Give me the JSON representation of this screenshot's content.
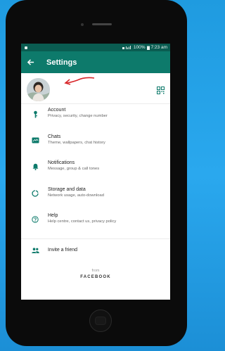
{
  "statusbar": {
    "battery": "100%",
    "time": "7:23 am"
  },
  "appbar": {
    "title": "Settings"
  },
  "menu": [
    {
      "icon": "key-icon",
      "title": "Account",
      "subtitle": "Privacy, security, change number"
    },
    {
      "icon": "chat-icon",
      "title": "Chats",
      "subtitle": "Theme, wallpapers, chat history"
    },
    {
      "icon": "bell-icon",
      "title": "Notifications",
      "subtitle": "Message, group & call tones"
    },
    {
      "icon": "data-usage-icon",
      "title": "Storage and data",
      "subtitle": "Network usage, auto-download"
    },
    {
      "icon": "help-icon",
      "title": "Help",
      "subtitle": "Help centre, contact us, privacy policy"
    }
  ],
  "invite": {
    "icon": "people-icon",
    "label": "Invite a friend"
  },
  "footer": {
    "from": "from",
    "brand": "FACEBOOK"
  },
  "colors": {
    "appbar": "#0d7a6b",
    "statusbar": "#0a5c51",
    "icon": "#0d7a6b",
    "annotation_arrow": "#d8262a",
    "background": "#2aa8ee"
  }
}
